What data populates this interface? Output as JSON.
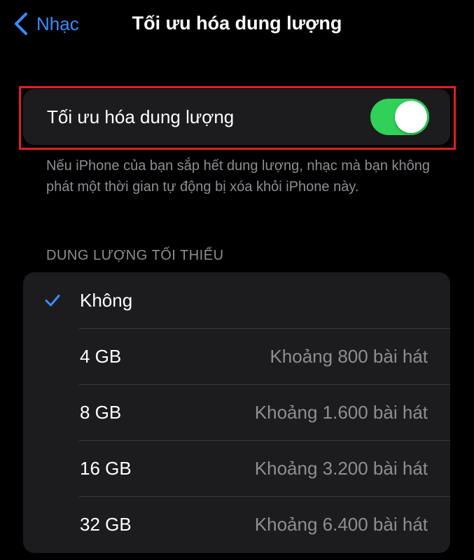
{
  "nav": {
    "back_label": "Nhạc",
    "title": "Tối ưu hóa dung lượng"
  },
  "toggle": {
    "label": "Tối ưu hóa dung lượng",
    "on": true,
    "on_color": "#30d158",
    "highlight_color": "#e01f26"
  },
  "footer_note": "Nếu iPhone của bạn sắp hết dung lượng, nhạc mà bạn không phát một thời gian tự động bị xóa khỏi iPhone này.",
  "section_header": "DUNG LƯỢNG TỐI THIỂU",
  "accent_color": "#3a8cff",
  "options": [
    {
      "label": "Không",
      "detail": "",
      "selected": true
    },
    {
      "label": "4 GB",
      "detail": "Khoảng 800 bài hát",
      "selected": false
    },
    {
      "label": "8 GB",
      "detail": "Khoảng 1.600 bài hát",
      "selected": false
    },
    {
      "label": "16 GB",
      "detail": "Khoảng 3.200 bài hát",
      "selected": false
    },
    {
      "label": "32 GB",
      "detail": "Khoảng 6.400 bài hát",
      "selected": false
    }
  ]
}
